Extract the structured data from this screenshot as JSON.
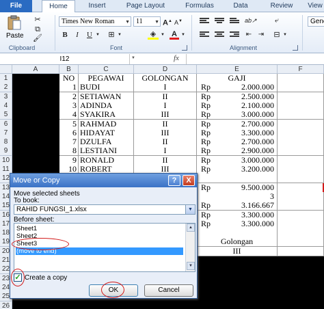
{
  "ribbon": {
    "tabs": [
      "File",
      "Home",
      "Insert",
      "Page Layout",
      "Formulas",
      "Data",
      "Review",
      "View"
    ],
    "paste_label": "Paste",
    "font_name": "Times New Roman",
    "font_size": "11",
    "bold": "B",
    "italic": "I",
    "underline": "U",
    "number_format_partial": "Gene",
    "group_clipboard": "Clipboard",
    "group_font": "Font",
    "group_alignment": "Alignment"
  },
  "formula_bar": {
    "name_box": "I12",
    "fx": "fx"
  },
  "grid": {
    "columns": [
      "A",
      "B",
      "C",
      "D",
      "E",
      "F"
    ],
    "rows": [
      "1",
      "2",
      "3",
      "4",
      "5",
      "6",
      "7",
      "8",
      "9",
      "10",
      "11",
      "12",
      "13",
      "14",
      "15",
      "16",
      "17",
      "18",
      "19",
      "20",
      "21",
      "22",
      "23",
      "24",
      "25",
      "26"
    ],
    "header_row": {
      "no": "NO",
      "pegawai": "PEGAWAI",
      "golongan": "GOLONGAN",
      "gaji": "GAJI"
    },
    "records": [
      {
        "no": "1",
        "name": "BUDI",
        "gol": "I",
        "rp": "Rp",
        "gaji": "2.000.000"
      },
      {
        "no": "2",
        "name": "SETIAWAN",
        "gol": "II",
        "rp": "Rp",
        "gaji": "2.500.000"
      },
      {
        "no": "3",
        "name": "ADINDA",
        "gol": "I",
        "rp": "Rp",
        "gaji": "2.100.000"
      },
      {
        "no": "4",
        "name": "SYAKIRA",
        "gol": "III",
        "rp": "Rp",
        "gaji": "3.000.000"
      },
      {
        "no": "5",
        "name": "RAHMAD",
        "gol": "II",
        "rp": "Rp",
        "gaji": "2.700.000"
      },
      {
        "no": "6",
        "name": "HIDAYAT",
        "gol": "III",
        "rp": "Rp",
        "gaji": "3.300.000"
      },
      {
        "no": "7",
        "name": "DZULFA",
        "gol": "II",
        "rp": "Rp",
        "gaji": "2.700.000"
      },
      {
        "no": "8",
        "name": "LESTIANI",
        "gol": "I",
        "rp": "Rp",
        "gaji": "2.900.000"
      },
      {
        "no": "9",
        "name": "RONALD",
        "gol": "II",
        "rp": "Rp",
        "gaji": "3.000.000"
      },
      {
        "no": "10",
        "name": "ROBERT",
        "gol": "III",
        "rp": "Rp",
        "gaji": "3.200.000"
      }
    ],
    "summary": [
      {
        "rp": "Rp",
        "value": "9.500.000"
      },
      {
        "rp": "",
        "value": "3"
      },
      {
        "rp": "Rp",
        "value": "3.166.667"
      },
      {
        "rp": "Rp",
        "value": "3.300.000"
      },
      {
        "rp": "Rp",
        "value": "3.300.000"
      }
    ],
    "golongan_label": "Golongan",
    "golongan_value": "III"
  },
  "dialog": {
    "title": "Move or Copy",
    "help": "?",
    "close": "X",
    "move_label": "Move selected sheets",
    "to_book_label": "To book:",
    "to_book_value": "RAHID FUNGSI_1.xlsx",
    "before_sheet_label": "Before sheet:",
    "sheets": [
      "Sheet1",
      "Sheet2",
      "Sheet3",
      "(move to end)"
    ],
    "create_copy_label": "Create a copy",
    "create_copy_checked": true,
    "ok": "OK",
    "cancel": "Cancel"
  }
}
